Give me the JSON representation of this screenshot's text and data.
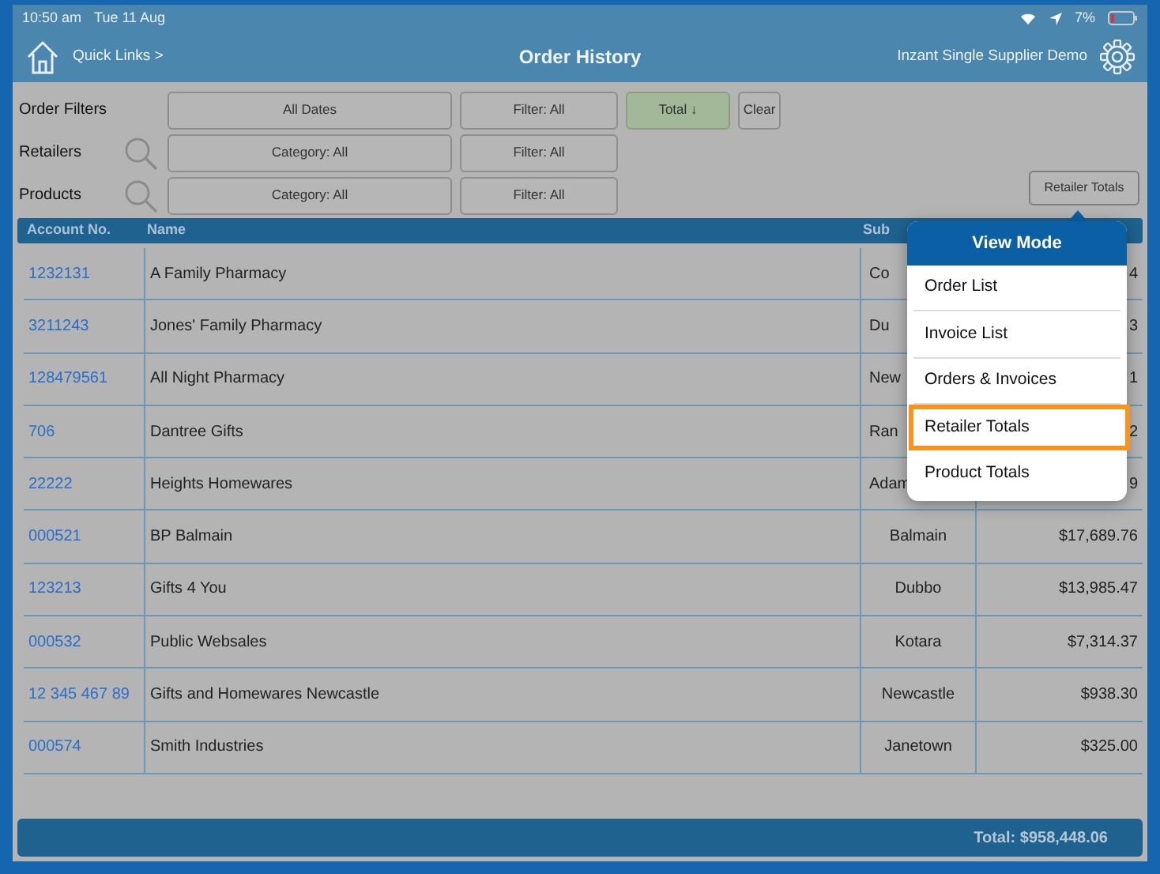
{
  "status_bar": {
    "time": "10:50 am",
    "date": "Tue 11 Aug",
    "battery": "7%"
  },
  "nav": {
    "back_link": "Quick Links >",
    "title": "Order History",
    "account": "Inzant Single Supplier Demo"
  },
  "filters": [
    {
      "label": "Order Filters",
      "search": false,
      "controls": [
        {
          "text": "All Dates",
          "kind": "wide",
          "selected": false
        },
        {
          "text": "Filter: All",
          "kind": "mid",
          "selected": false
        },
        {
          "text": "Total ↓",
          "kind": "sort",
          "selected": true
        },
        {
          "text": "Clear",
          "kind": "small",
          "selected": false
        }
      ]
    },
    {
      "label": "Retailers",
      "search": true,
      "controls": [
        {
          "text": "Category: All",
          "kind": "wide",
          "selected": false
        },
        {
          "text": "Filter: All",
          "kind": "mid",
          "selected": false
        }
      ]
    },
    {
      "label": "Products",
      "search": true,
      "controls": [
        {
          "text": "Category: All",
          "kind": "wide",
          "selected": false
        },
        {
          "text": "Filter: All",
          "kind": "mid",
          "selected": false
        }
      ]
    }
  ],
  "view_button": "Retailer Totals",
  "table": {
    "columns": [
      "Account No.",
      "Name",
      "Sub"
    ],
    "rows": [
      {
        "account": "1232131",
        "name": "A Family Pharmacy",
        "suburb": "Co",
        "total": "4",
        "covered": true
      },
      {
        "account": "3211243",
        "name": "Jones' Family Pharmacy",
        "suburb": "Du",
        "total": "3",
        "covered": true
      },
      {
        "account": "128479561",
        "name": "All Night Pharmacy",
        "suburb": "New",
        "total": "1",
        "covered": true
      },
      {
        "account": "706",
        "name": "Dantree Gifts",
        "suburb": "Ran",
        "total": "2",
        "covered": true
      },
      {
        "account": "22222",
        "name": "Heights Homewares",
        "suburb": "Adam",
        "total": "9",
        "covered": true
      },
      {
        "account": "000521",
        "name": "BP Balmain",
        "suburb": "Balmain",
        "total": "$17,689.76",
        "covered": false
      },
      {
        "account": "123213",
        "name": "Gifts 4 You",
        "suburb": "Dubbo",
        "total": "$13,985.47",
        "covered": false
      },
      {
        "account": "000532",
        "name": "Public Websales",
        "suburb": "Kotara",
        "total": "$7,314.37",
        "covered": false
      },
      {
        "account": "12 345 467 89",
        "name": "Gifts and Homewares Newcastle",
        "suburb": "Newcastle",
        "total": "$938.30",
        "covered": false
      },
      {
        "account": "000574",
        "name": "Smith Industries",
        "suburb": "Janetown",
        "total": "$325.00",
        "covered": false
      }
    ]
  },
  "footer_total": "Total: $958,448.06",
  "view_mode_menu": {
    "title": "View Mode",
    "items": [
      {
        "label": "Order List",
        "selected": false
      },
      {
        "label": "Invoice List",
        "selected": false
      },
      {
        "label": "Orders & Invoices",
        "selected": false
      },
      {
        "label": "Retailer Totals",
        "selected": true
      },
      {
        "label": "Product Totals",
        "selected": false
      }
    ]
  }
}
